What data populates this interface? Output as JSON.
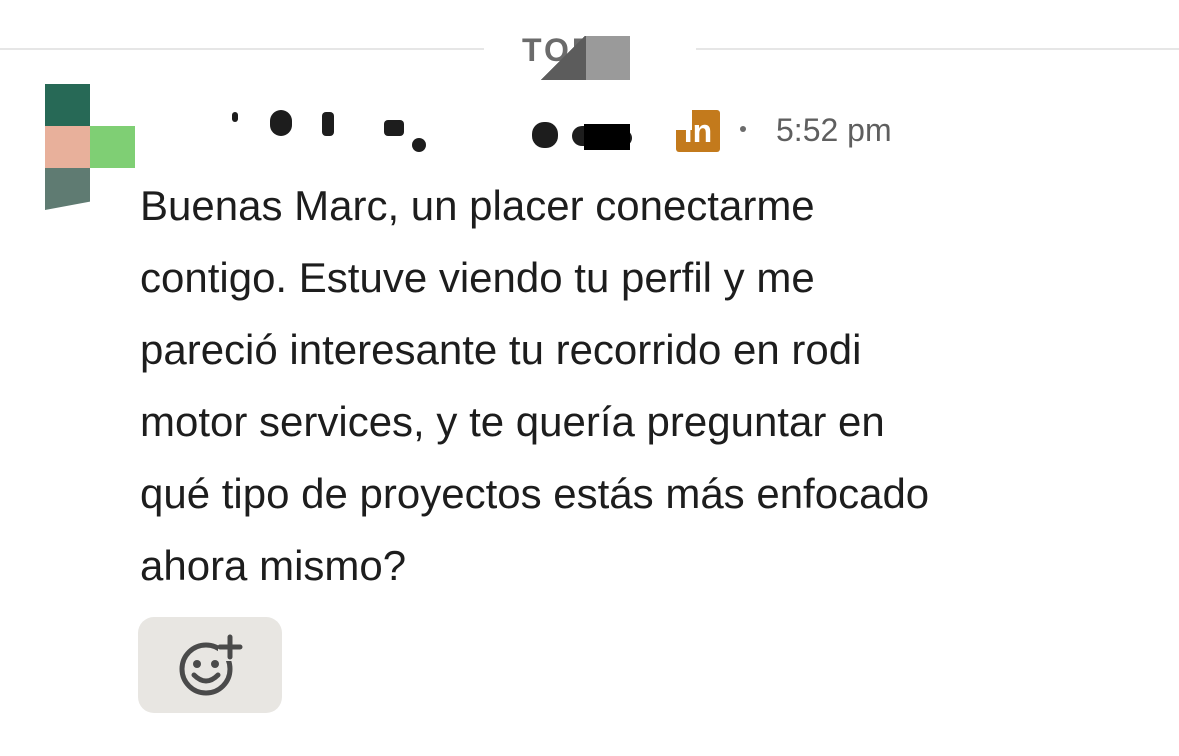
{
  "divider": {
    "label": "TOD"
  },
  "message": {
    "sender_badge": "in",
    "timestamp": "5:52 pm",
    "lines": [
      "Buenas Marc, un placer conectarme",
      "contigo. Estuve viendo tu perfil y me",
      "pareció interesante tu recorrido en rodi",
      "motor services, y te quería preguntar en",
      "qué tipo de proyectos estás más enfocado",
      "ahora mismo?"
    ]
  },
  "reaction": {
    "icon": "add-reaction-icon"
  },
  "colors": {
    "badge": "#c37a1c",
    "reaction_bg": "#e8e6e2",
    "divider_line": "#e6e6e6"
  }
}
